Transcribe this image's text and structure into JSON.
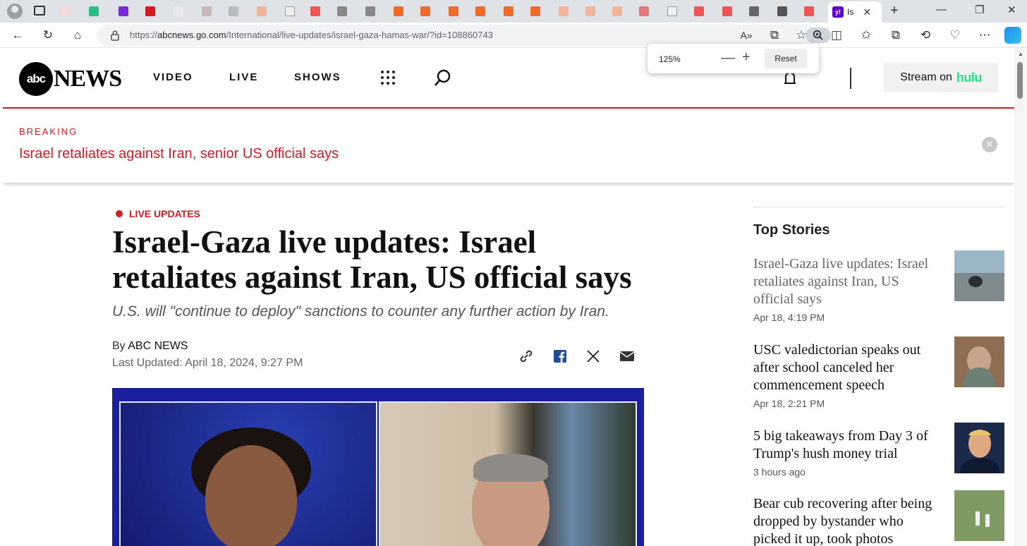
{
  "browser": {
    "active_tab_title": "Is",
    "url_prefix": "https://",
    "url_host": "abcnews.go.com",
    "url_path": "/International/live-updates/israel-gaza-hamas-war/?id=108860743",
    "zoom_popup": {
      "level": "125%",
      "reset_label": "Reset"
    }
  },
  "site": {
    "logo_mark": "abc",
    "logo_text": "NEWS",
    "nav": [
      "VIDEO",
      "LIVE",
      "SHOWS"
    ],
    "hulu_prefix": "Stream on",
    "hulu_brand": "hulu"
  },
  "breaking": {
    "label": "BREAKING",
    "headline": "Israel retaliates against Iran, senior US official says"
  },
  "article": {
    "tag": "LIVE UPDATES",
    "title": "Israel-Gaza live updates: Israel retaliates against Iran, US official says",
    "subtitle": "U.S. will \"continue to deploy\" sanctions to counter any further action by Iran.",
    "by_prefix": "By",
    "author": "ABC NEWS",
    "updated": "Last Updated: April 18, 2024, 9:27 PM"
  },
  "sidebar": {
    "heading": "Top Stories",
    "stories": [
      {
        "title": "Israel-Gaza live updates: Israel retaliates against Iran, US official says",
        "date": "Apr 18, 4:19 PM"
      },
      {
        "title": "USC valedictorian speaks out after school canceled her commencement speech",
        "date": "Apr 18, 2:21 PM"
      },
      {
        "title": "5 big takeaways from Day 3 of Trump's hush money trial",
        "date": "3 hours ago"
      },
      {
        "title": "Bear cub recovering after being dropped by bystander who picked it up, took photos",
        "date": ""
      }
    ]
  },
  "colors": {
    "accent": "#d71921",
    "hulu": "#1ce783"
  }
}
